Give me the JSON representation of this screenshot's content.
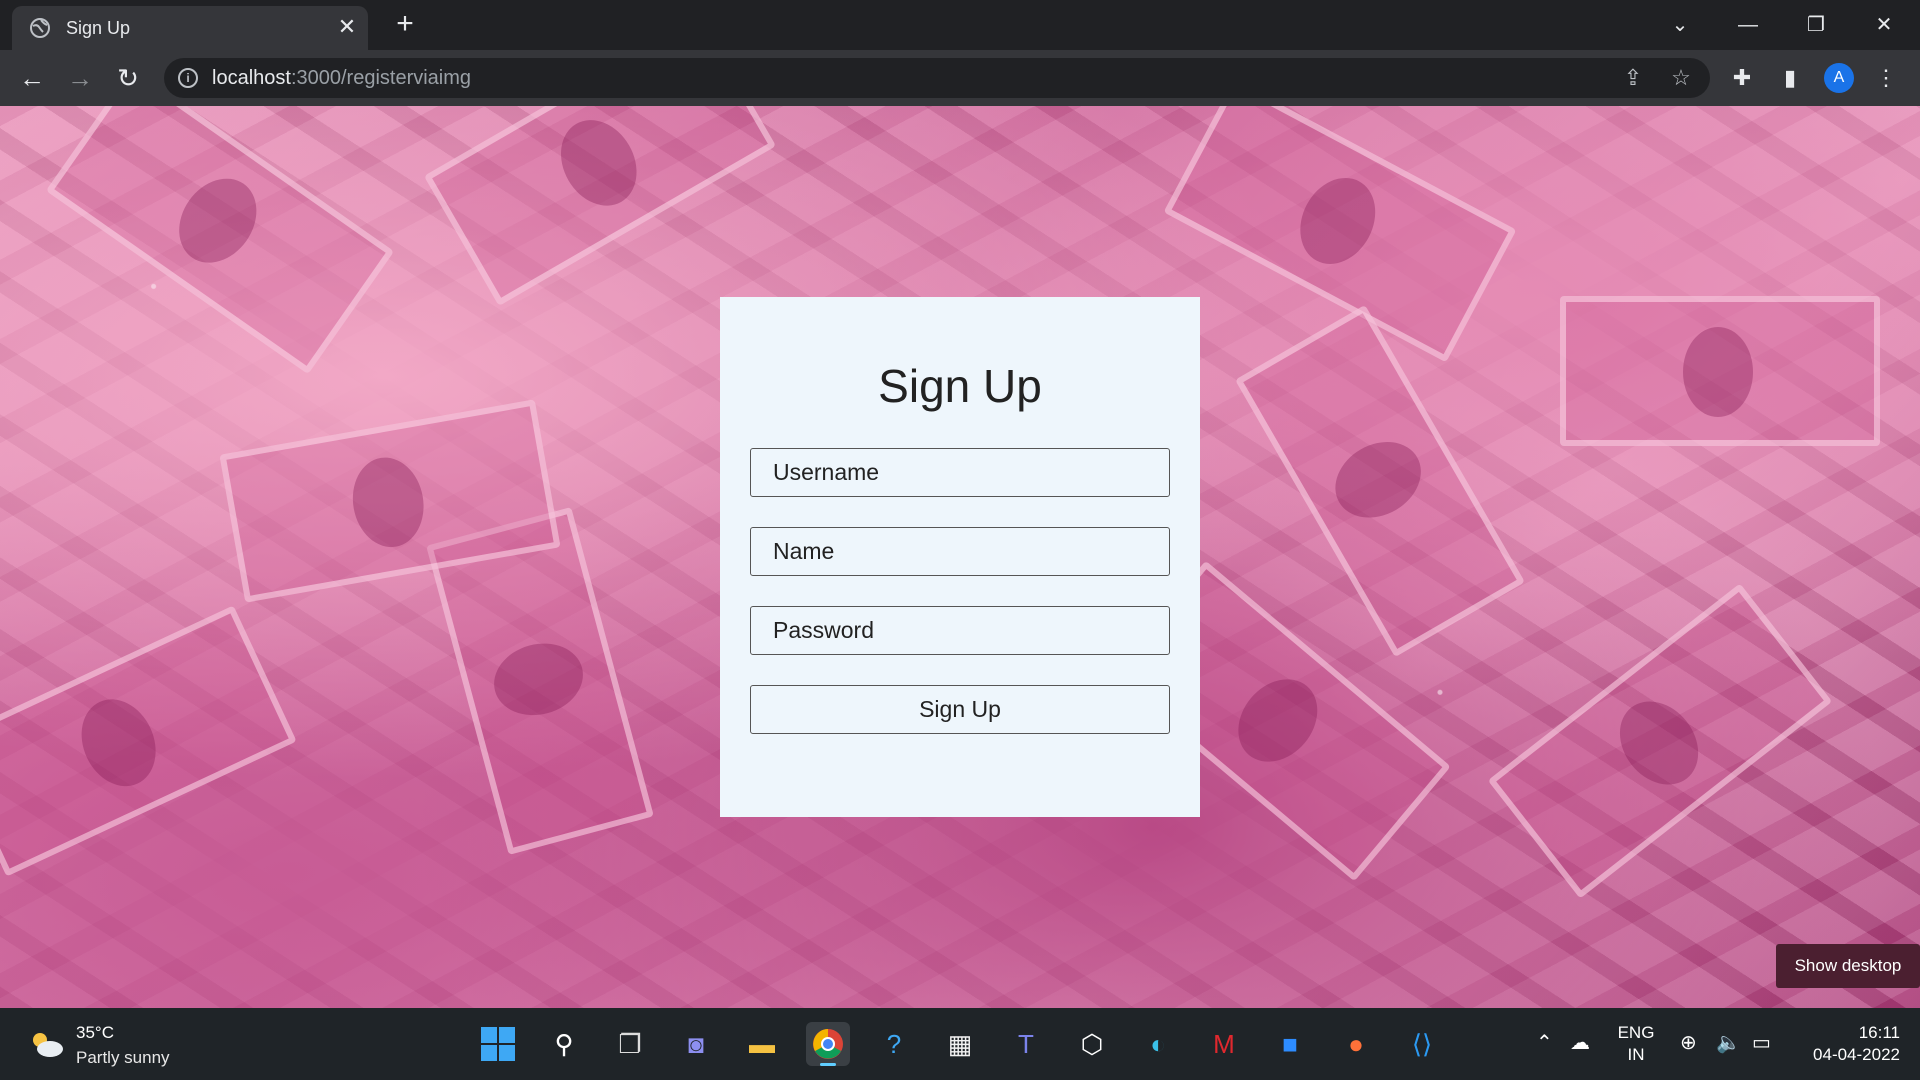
{
  "browser": {
    "tab_title": "Sign Up",
    "tab_close": "✕",
    "new_tab": "+",
    "url_host": "localhost",
    "url_rest": ":3000/registerviaimg"
  },
  "form": {
    "title": "Sign Up",
    "username_placeholder": "Username",
    "name_placeholder": "Name",
    "password_placeholder": "Password",
    "submit_label": "Sign Up"
  },
  "tooltip": "Show desktop",
  "taskbar": {
    "weather_temp": "35°C",
    "weather_desc": "Partly sunny",
    "lang_line1": "ENG",
    "lang_line2": "IN",
    "time": "16:11",
    "date": "04-04-2022"
  },
  "colors": {
    "card_bg": "#eef6fc",
    "chrome_dark": "#202124",
    "chrome_toolbar": "#35363a",
    "taskbar_bg": "#1f2428",
    "profile_blue": "#1a73e8"
  },
  "icons": [
    "globe-icon",
    "back-arrow-icon",
    "forward-arrow-icon",
    "reload-icon",
    "info-icon",
    "share-icon",
    "star-icon",
    "extensions-icon",
    "side-panel-icon",
    "kebab-menu-icon",
    "windows-start-icon",
    "search-icon",
    "task-view-icon",
    "chat-icon",
    "file-explorer-icon",
    "chrome-icon",
    "help-icon",
    "store-icon",
    "teams-icon",
    "app-icon",
    "edge-icon",
    "mcafee-icon",
    "zoom-icon",
    "firefox-icon",
    "vscode-icon"
  ],
  "profile_initial": "A"
}
